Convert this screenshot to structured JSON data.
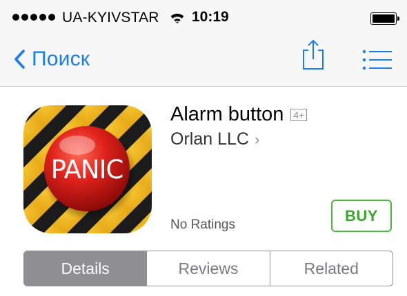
{
  "status_bar": {
    "signal_dots": 5,
    "carrier": "UA-KYIVSTAR",
    "time": "10:19",
    "battery_level": 1.0
  },
  "navbar": {
    "back_label": "Поиск",
    "share_icon": "share-icon",
    "list_icon": "list-icon"
  },
  "app": {
    "icon_text": "PANIC",
    "title": "Alarm button",
    "age_rating": "4+",
    "developer": "Orlan LLC",
    "developer_chevron": "›",
    "ratings": "No Ratings",
    "buy_label": "BUY"
  },
  "tabs": [
    {
      "label": "Details",
      "active": true
    },
    {
      "label": "Reviews",
      "active": false
    },
    {
      "label": "Related",
      "active": false
    }
  ],
  "colors": {
    "accent_blue": "#1a7cf2",
    "buy_green": "#3ba62c",
    "segment_gray": "#8e8e93"
  }
}
